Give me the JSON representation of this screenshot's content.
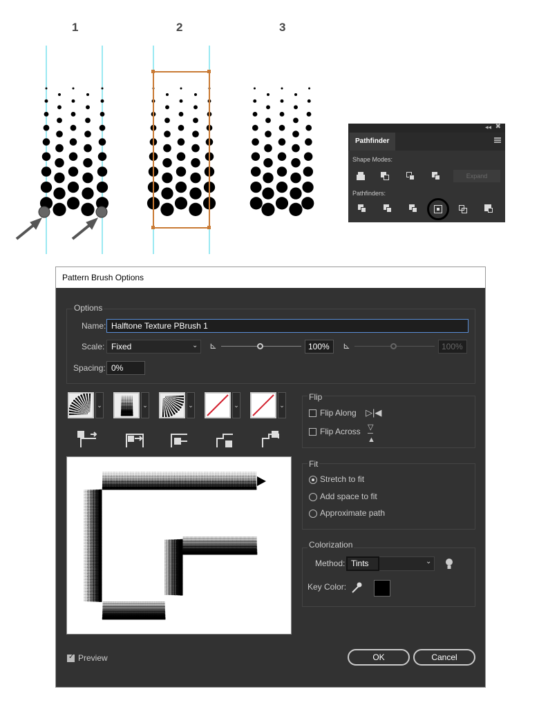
{
  "steps": {
    "labels": [
      "1",
      "2",
      "3"
    ]
  },
  "pathfinder": {
    "tab_label": "Pathfinder",
    "shape_modes_label": "Shape Modes:",
    "expand_label": "Expand",
    "pathfinders_label": "Pathfinders:",
    "icons": [
      "unite-icon",
      "minus-front-icon",
      "intersect-icon",
      "exclude-icon",
      "divide-icon",
      "trim-icon",
      "merge-icon",
      "crop-icon",
      "outline-icon",
      "minus-back-icon"
    ]
  },
  "dialog": {
    "title": "Pattern Brush Options",
    "options_label": "Options",
    "name_label": "Name:",
    "name_value": "Halftone Texture PBrush 1",
    "scale_label": "Scale:",
    "scale_value": "Fixed",
    "scale_percent": "100%",
    "scale_percent2": "100%",
    "spacing_label": "Spacing:",
    "spacing_value": "0%",
    "flip_label": "Flip",
    "flip_along": "Flip Along",
    "flip_across": "Flip Across",
    "fit_label": "Fit",
    "fit_options": [
      "Stretch to fit",
      "Add space to fit",
      "Approximate path"
    ],
    "fit_selected": 0,
    "colorization_label": "Colorization",
    "method_label": "Method:",
    "method_value": "Tints",
    "key_color_label": "Key Color:",
    "key_color": "#000000",
    "preview_label": "Preview",
    "preview_checked": true,
    "ok_label": "OK",
    "cancel_label": "Cancel"
  },
  "colors": {
    "guide": "#36d3e6",
    "bbox": "#c97a34",
    "panel_bg": "#323232",
    "title_bg": "#ffffff"
  }
}
